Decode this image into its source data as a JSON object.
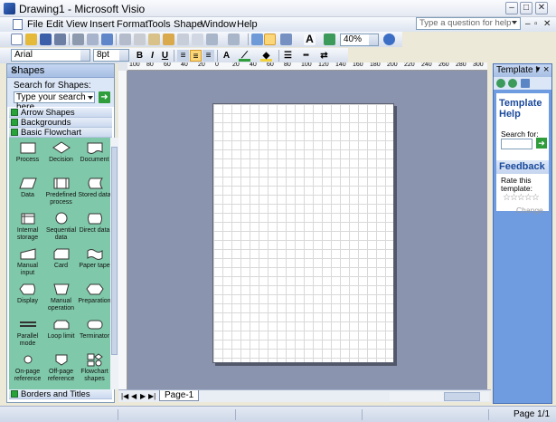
{
  "window": {
    "title": "Drawing1 - Microsoft Visio"
  },
  "menu": {
    "items": [
      "File",
      "Edit",
      "View",
      "Insert",
      "Format",
      "Tools",
      "Shape",
      "Window",
      "Help"
    ],
    "ask_placeholder": "Type a question for help"
  },
  "toolbar": {
    "zoom": "40%",
    "font": "Arial",
    "font_size": "8pt"
  },
  "shapes_panel": {
    "title": "Shapes",
    "search_label": "Search for Shapes:",
    "search_placeholder": "Type your search here",
    "stencils": [
      "Arrow Shapes",
      "Backgrounds",
      "Basic Flowchart Shapes",
      "Borders and Titles"
    ],
    "shapes": [
      "Process",
      "Decision",
      "Document",
      "Data",
      "Predefined process",
      "Stored data",
      "Internal storage",
      "Sequential data",
      "Direct data",
      "Manual input",
      "Card",
      "Paper tape",
      "Display",
      "Manual operation",
      "Preparation",
      "Parallel mode",
      "Loop limit",
      "Terminator",
      "On-page reference",
      "Off-page reference",
      "Flowchart shapes"
    ]
  },
  "ruler": {
    "h_labels": [
      "100",
      "80",
      "60",
      "40",
      "20",
      "0",
      "20",
      "40",
      "60",
      "80",
      "100",
      "120",
      "140",
      "160",
      "180",
      "200",
      "220",
      "240",
      "260",
      "280",
      "300"
    ]
  },
  "tabs": {
    "page_tab": "Page-1"
  },
  "task_pane": {
    "title": "Template I",
    "section1": "Template Help",
    "search_for": "Search for:",
    "feedback": "Feedback",
    "rate": "Rate this template:",
    "change": "Change..."
  },
  "status": {
    "page": "Page 1/1"
  }
}
